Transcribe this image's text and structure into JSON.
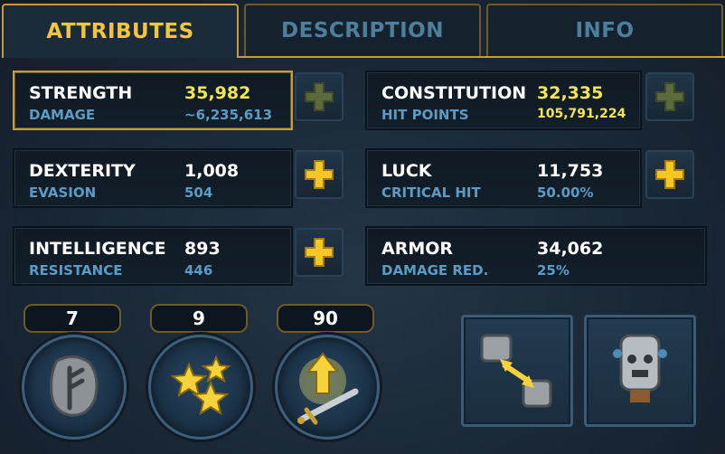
{
  "tabs": [
    {
      "label": "ATTRIBUTES",
      "active": true
    },
    {
      "label": "DESCRIPTION",
      "active": false
    },
    {
      "label": "INFO",
      "active": false
    }
  ],
  "stats": {
    "strength": {
      "name": "STRENGTH",
      "value": "35,982",
      "sub_label": "DAMAGE",
      "sub_value": "~6,235,613"
    },
    "dexterity": {
      "name": "DEXTERITY",
      "value": "1,008",
      "sub_label": "EVASION",
      "sub_value": "504"
    },
    "intelligence": {
      "name": "INTELLIGENCE",
      "value": "893",
      "sub_label": "RESISTANCE",
      "sub_value": "446"
    },
    "constitution": {
      "name": "CONSTITUTION",
      "value": "32,335",
      "sub_label": "HIT POINTS",
      "sub_value": "105,791,224"
    },
    "luck": {
      "name": "LUCK",
      "value": "11,753",
      "sub_label": "CRITICAL HIT",
      "sub_value": "50.00%"
    },
    "armor": {
      "name": "ARMOR",
      "value": "34,062",
      "sub_label": "DAMAGE RED.",
      "sub_value": "25%"
    }
  },
  "counters": {
    "rune": "7",
    "stars": "9",
    "upgrade": "90"
  },
  "icons": {
    "plus_disabled": "plus-icon-disabled",
    "plus_active": "plus-icon",
    "rune": "rune-stone-icon",
    "stars": "stars-icon",
    "upgrade": "sword-upgrade-icon",
    "swap": "armor-swap-icon",
    "mannequin": "mannequin-icon"
  },
  "colors": {
    "accent_gold": "#f2c53f",
    "value_yellow": "#f4e45a",
    "sub_blue": "#5c9cc4",
    "tab_inactive": "#4d7f9a"
  }
}
